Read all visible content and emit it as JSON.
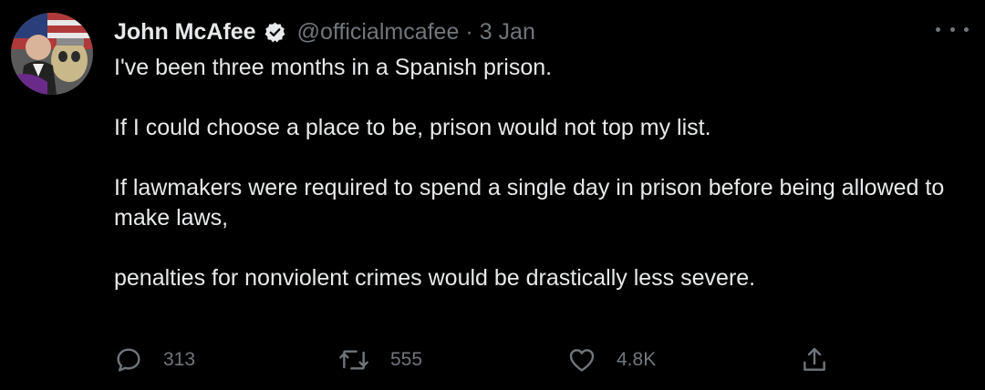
{
  "tweet": {
    "author": {
      "display_name": "John McAfee",
      "handle": "@officialmcafee",
      "verified": true,
      "verified_icon": "verified-badge-icon"
    },
    "separator": "·",
    "timestamp": "3 Jan",
    "more_icon": "more-dots-icon",
    "paragraphs": [
      "I've been three months in a Spanish prison.",
      "If I could choose a place to be, prison would not top my list.",
      "If lawmakers were required to spend a single day in prison before being allowed to make laws,",
      "penalties for nonviolent crimes would be drastically less severe."
    ],
    "actions": {
      "reply": {
        "icon": "reply-icon",
        "count": "313"
      },
      "retweet": {
        "icon": "retweet-icon",
        "count": "555"
      },
      "like": {
        "icon": "heart-icon",
        "count": "4.8K"
      },
      "share": {
        "icon": "share-icon"
      }
    }
  },
  "colors": {
    "background": "#000000",
    "text_primary": "#e7e9ea",
    "text_secondary": "#71767b"
  }
}
